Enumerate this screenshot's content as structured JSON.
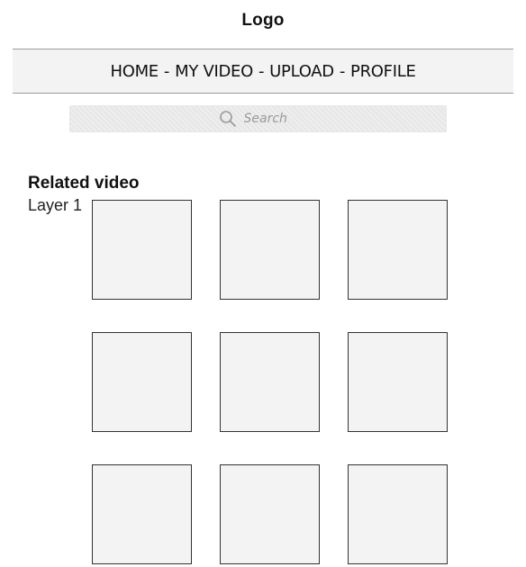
{
  "header": {
    "logo": "Logo"
  },
  "nav": {
    "items": [
      {
        "label": "HOME"
      },
      {
        "label": "MY VIDEO"
      },
      {
        "label": "UPLOAD"
      },
      {
        "label": "PROFILE"
      }
    ],
    "separator": "-"
  },
  "search": {
    "placeholder": "Search",
    "icon": "search-icon"
  },
  "related": {
    "title": "Related video",
    "layer_label": "Layer 1",
    "thumbnails": [
      {
        "id": "thumb-1"
      },
      {
        "id": "thumb-2"
      },
      {
        "id": "thumb-3"
      },
      {
        "id": "thumb-4"
      },
      {
        "id": "thumb-5"
      },
      {
        "id": "thumb-6"
      },
      {
        "id": "thumb-7"
      },
      {
        "id": "thumb-8"
      },
      {
        "id": "thumb-9"
      }
    ]
  },
  "colors": {
    "nav_background": "#f3f3f3",
    "thumbnail_fill": "#f3f3f3",
    "search_background": "#ececec",
    "placeholder_text": "#9a9a9a"
  }
}
